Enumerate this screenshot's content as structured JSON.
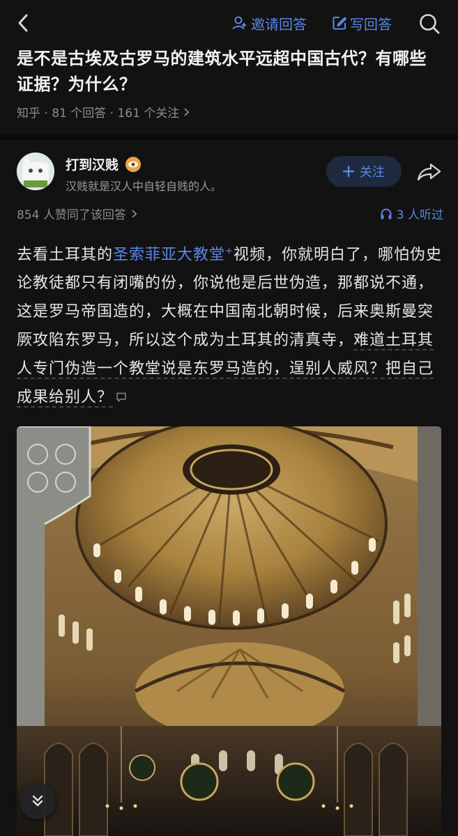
{
  "header": {
    "invite_label": "邀请回答",
    "write_label": "写回答"
  },
  "question": {
    "title": "是不是古埃及古罗马的建筑水平远超中国古代？有哪些证据？为什么？",
    "meta": "知乎 · 81 个回答 · 161 个关注"
  },
  "author": {
    "name": "打到汉贱",
    "bio": "汉贱就是汉人中自轻自贱的人。",
    "follow_label": "关注"
  },
  "stats": {
    "upvotes": "854 人赞同了该回答",
    "listened": "3 人听过"
  },
  "answer": {
    "prefix": "去看土耳其的",
    "link_text": "圣索菲亚大教堂",
    "link_sup": "+",
    "body": "视频，你就明白了，哪怕伪史论教徒都只有闭嘴的份，你说他是后世伪造，那都说不通，这是罗马帝国造的，大概在中国南北朝时候，后来奥斯曼突厥攻陷东罗马，所以这个成为土耳其的清真寺，",
    "underlined": "难道土耳其人专门伪造一个教堂说是东罗马造的，逞别人威风？把自己成果给别人？"
  },
  "icons": {
    "back": "chevron-left-icon",
    "invite": "person-plus-icon",
    "write": "pencil-square-icon",
    "search": "search-icon",
    "badge": "eye-badge-icon",
    "share": "share-arrow-icon",
    "headphones": "headphones-icon",
    "comment": "comment-bubble-icon",
    "collapse": "double-chevron-down-icon"
  },
  "colors": {
    "accent": "#5b86e6",
    "background": "#121212",
    "text": "#e6e6e6",
    "muted": "#8c8c8c"
  }
}
